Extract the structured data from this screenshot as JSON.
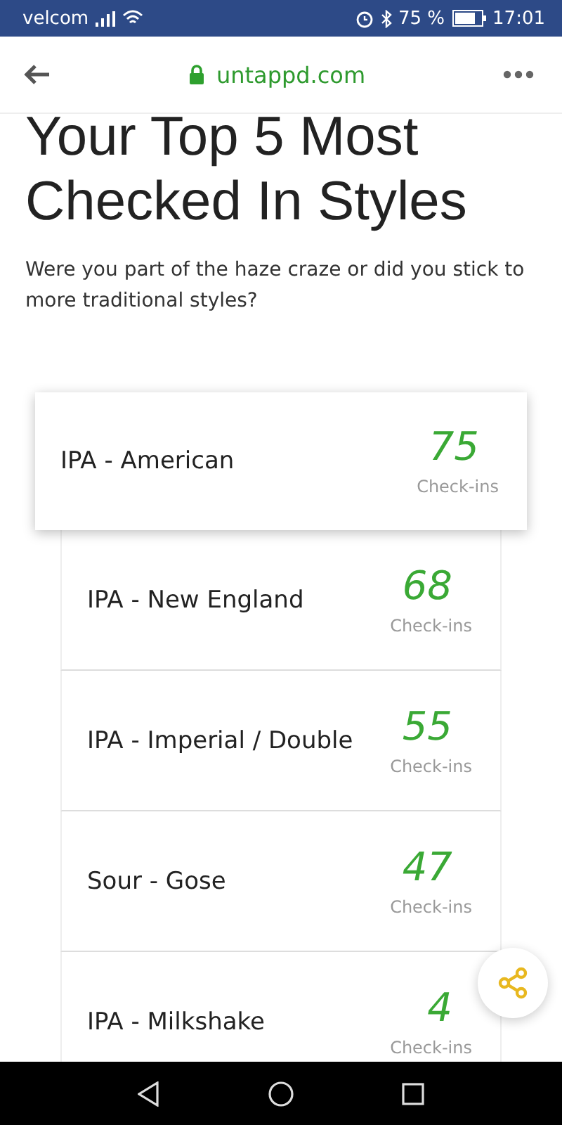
{
  "status_bar": {
    "carrier": "velcom",
    "battery": "75 %",
    "time": "17:01"
  },
  "address_bar": {
    "url": "untappd.com"
  },
  "heading": "Your Top 5 Most Checked In Styles",
  "subtitle": "Were you part of the haze craze or did you stick to more traditional styles?",
  "styles": [
    {
      "name": "IPA - American",
      "count": "75",
      "count_label": "Check-ins",
      "selected": true
    },
    {
      "name": "IPA - New England",
      "count": "68",
      "count_label": "Check-ins",
      "selected": false
    },
    {
      "name": "IPA - Imperial / Double",
      "count": "55",
      "count_label": "Check-ins",
      "selected": false
    },
    {
      "name": "Sour - Gose",
      "count": "47",
      "count_label": "Check-ins",
      "selected": false
    },
    {
      "name": "IPA - Milkshake",
      "count": "4",
      "count_label": "Check-ins",
      "selected": false
    }
  ]
}
